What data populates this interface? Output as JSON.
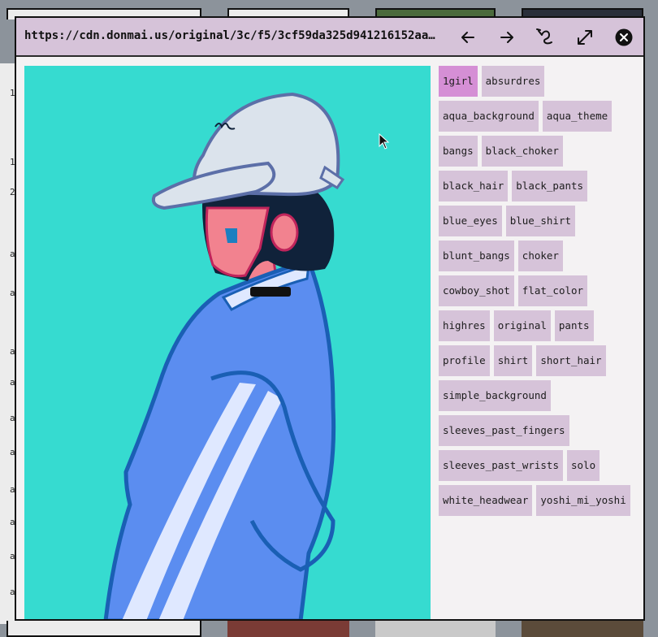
{
  "viewer": {
    "url": "https://cdn.donmai.us/original/3c/f5/3cf59da325d941216152aa…",
    "buttons": {
      "back": "arrow-left-icon",
      "forward": "arrow-right-icon",
      "reverse_search": "reverse-search-icon",
      "expand": "expand-icon",
      "close": "close-icon"
    }
  },
  "image": {
    "background": "#36dbd0"
  },
  "tags": [
    {
      "label": "1girl",
      "active": true
    },
    {
      "label": "absurdres"
    },
    {
      "label": "aqua_background"
    },
    {
      "label": "aqua_theme"
    },
    {
      "label": "bangs"
    },
    {
      "label": "black_choker"
    },
    {
      "label": "black_hair"
    },
    {
      "label": "black_pants"
    },
    {
      "label": "blue_eyes"
    },
    {
      "label": "blue_shirt"
    },
    {
      "label": "blunt_bangs"
    },
    {
      "label": "choker"
    },
    {
      "label": "cowboy_shot"
    },
    {
      "label": "flat_color"
    },
    {
      "label": "highres"
    },
    {
      "label": "original"
    },
    {
      "label": "pants"
    },
    {
      "label": "profile"
    },
    {
      "label": "shirt"
    },
    {
      "label": "short_hair"
    },
    {
      "label": "simple_background"
    },
    {
      "label": "sleeves_past_fingers"
    },
    {
      "label": "sleeves_past_wrists"
    },
    {
      "label": "solo"
    },
    {
      "label": "white_headwear"
    },
    {
      "label": "yoshi_mi_yoshi"
    }
  ],
  "colors": {
    "titlebar": "#d6c3d9",
    "tag": "#d6c3d9",
    "tag_active": "#d58fd5",
    "panel": "#f4f2f3"
  }
}
